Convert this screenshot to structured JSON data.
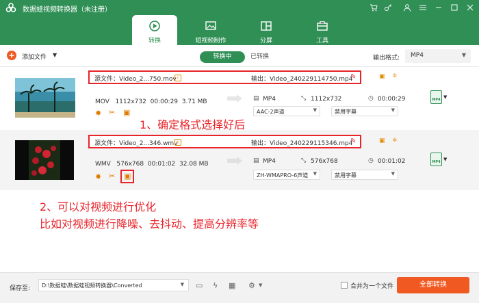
{
  "app": {
    "title": "数据蛙视频转换器（未注册）"
  },
  "nav": {
    "tabs": [
      {
        "label": "转换"
      },
      {
        "label": "短视频制作"
      },
      {
        "label": "分屏"
      },
      {
        "label": "工具"
      }
    ]
  },
  "toolbar": {
    "add_file": "添加文件",
    "seg_active": "转换中",
    "seg_other": "已转换",
    "output_format_label": "输出格式:",
    "output_format_value": "MP4"
  },
  "files": [
    {
      "source": "源文件：Video_2...750.mov",
      "output": "输出：Video_240229114750.mp4",
      "format": "MOV",
      "resolution": "1112x732",
      "duration": "00:00:29",
      "size": "3.71 MB",
      "target_format": "MP4",
      "target_resolution": "1112x732",
      "target_duration": "00:00:29",
      "audio": "AAC-2声道",
      "subtitle": "禁用字幕",
      "format_icon": "MP4"
    },
    {
      "source": "源文件：Video_2...346.wmv",
      "output": "输出：Video_240229115346.mp4",
      "format": "WMV",
      "resolution": "576x768",
      "duration": "00:01:02",
      "size": "32.08 MB",
      "target_format": "MP4",
      "target_resolution": "576x768",
      "target_duration": "00:01:02",
      "audio": "ZH-WMAPRO-6声道",
      "subtitle": "禁用字幕",
      "format_icon": "MP4"
    }
  ],
  "annotations": {
    "step1": "1、确定格式选择好后",
    "step2_line1": "2、可以对视频进行优化",
    "step2_line2": "比如对视频进行降噪、去抖动、提高分辨率等"
  },
  "footer": {
    "save_label": "保存至:",
    "save_path": "D:\\数据蛙\\数据蛙视频转换器\\Converted",
    "merge_label": "合并为一个文件",
    "convert_all": "全部转换"
  },
  "colors": {
    "brand_green": "#2f8f55",
    "accent_orange": "#f05a22",
    "annotation_red": "#e8232a"
  }
}
